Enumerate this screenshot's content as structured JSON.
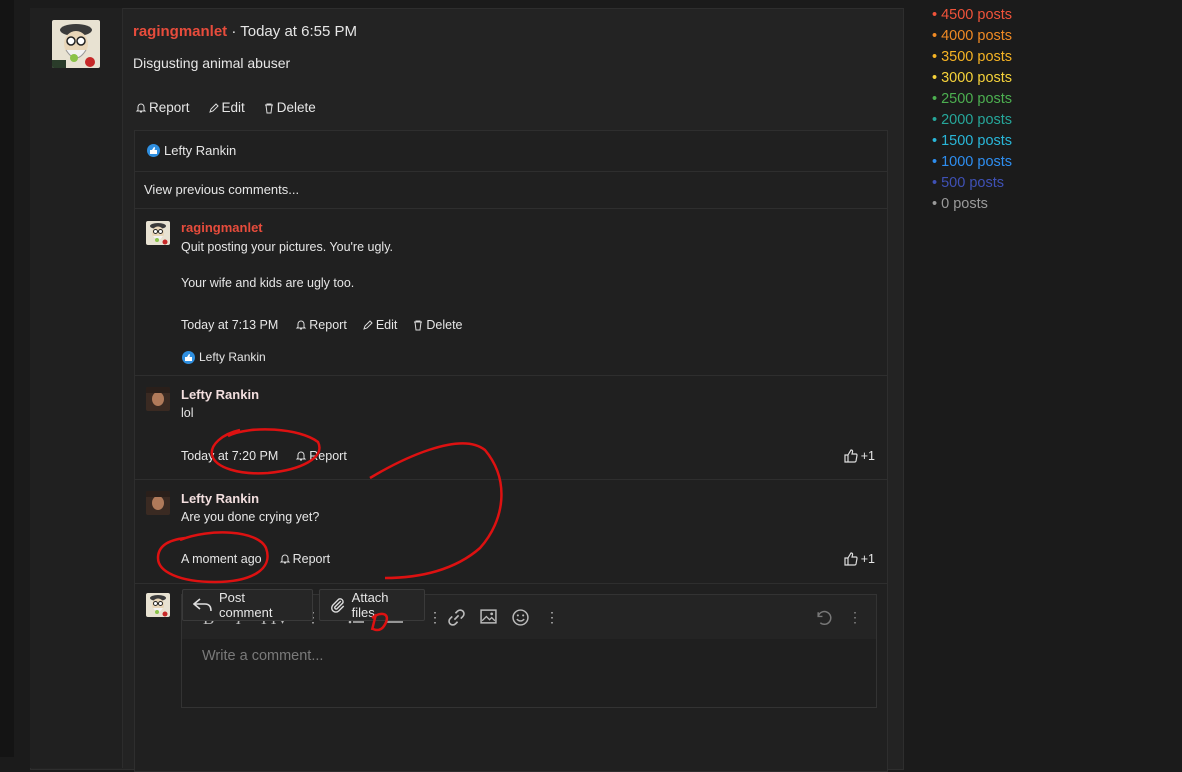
{
  "post": {
    "author": "ragingmanlet",
    "separator": " · ",
    "time": "Today at 6:55 PM",
    "message": "Disgusting animal abuser",
    "actions": {
      "report": "Report",
      "edit": "Edit",
      "delete": "Delete"
    }
  },
  "reactions": {
    "liked_by": "Lefty Rankin"
  },
  "view_previous": "View previous comments...",
  "comments": [
    {
      "author": "ragingmanlet",
      "body_line1": "Quit posting your pictures. You're ugly.",
      "body_line2": "Your wife and kids are ugly too.",
      "time": "Today at 7:13 PM",
      "report": "Report",
      "edit": "Edit",
      "delete": "Delete",
      "liked_by": "Lefty Rankin"
    },
    {
      "author": "Lefty Rankin",
      "body": "lol",
      "time": "Today at 7:20 PM",
      "report": "Report",
      "score": "+1"
    },
    {
      "author": "Lefty Rankin",
      "body": "Are you done crying yet?",
      "time": "A moment ago",
      "report": "Report",
      "score": "+1"
    }
  ],
  "editor": {
    "placeholder": "Write a comment...",
    "post_label": "Post comment",
    "attach_label": "Attach files"
  },
  "legend": [
    {
      "label": "4500 posts",
      "color": "#f0533a"
    },
    {
      "label": "4000 posts",
      "color": "#f08a24"
    },
    {
      "label": "3500 posts",
      "color": "#f5b324"
    },
    {
      "label": "3000 posts",
      "color": "#f5d23a"
    },
    {
      "label": "2500 posts",
      "color": "#4caf50"
    },
    {
      "label": "2000 posts",
      "color": "#26a69a"
    },
    {
      "label": "1500 posts",
      "color": "#29b6d8"
    },
    {
      "label": "1000 posts",
      "color": "#2e8ef0"
    },
    {
      "label": "500 posts",
      "color": "#3f51b5"
    },
    {
      "label": "0 posts",
      "color": "#9a9a9a"
    }
  ]
}
